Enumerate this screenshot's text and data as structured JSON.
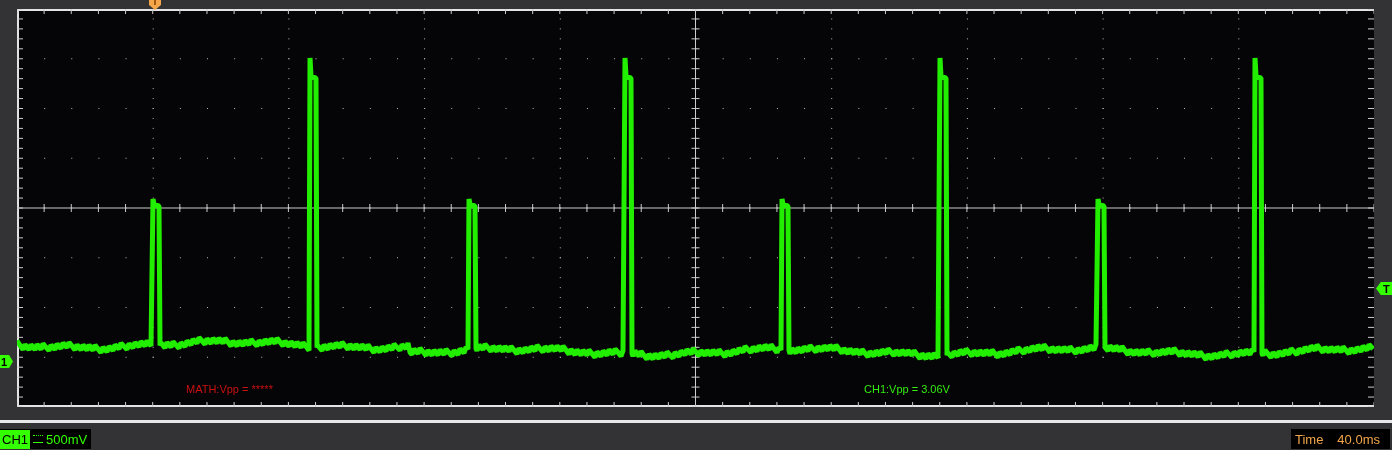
{
  "trigger_position_marker": {
    "kind": "trigger-position"
  },
  "channel_marker": {
    "label": "1"
  },
  "trigger_level_marker": {
    "label": "T"
  },
  "measurements": [
    {
      "text": "MATH:Vpp = *****",
      "color": "#cc1111"
    },
    {
      "text": "CH1:Vpp = 3.06V",
      "color": "#33ee11"
    }
  ],
  "status_bar": {
    "channel": {
      "label": "CH1",
      "scale": "500mV"
    },
    "time": {
      "label": "Time",
      "value": "40.0ms"
    }
  }
}
